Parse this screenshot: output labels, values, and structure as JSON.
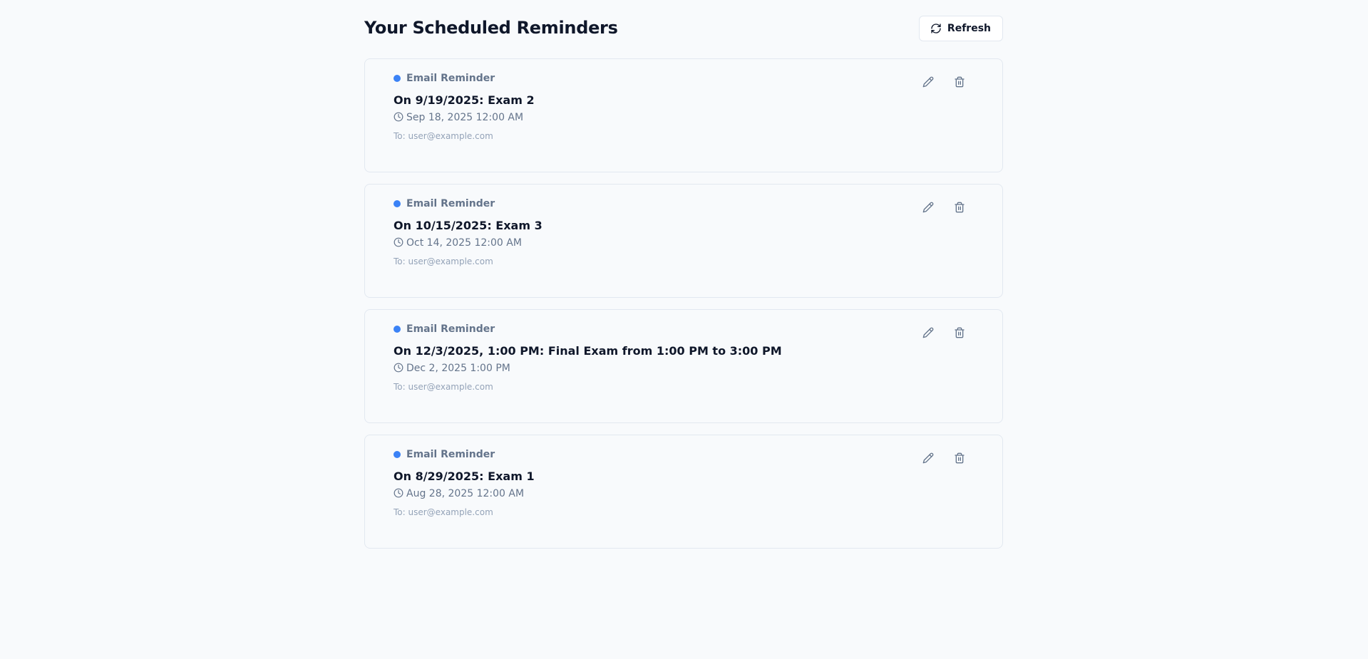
{
  "header": {
    "title": "Your Scheduled Reminders",
    "refresh_label": "Refresh"
  },
  "reminders": [
    {
      "type": "Email Reminder",
      "title": "On 9/19/2025: Exam 2",
      "time": "Sep 18, 2025 12:00 AM",
      "recipient": "To: user@example.com"
    },
    {
      "type": "Email Reminder",
      "title": "On 10/15/2025: Exam 3",
      "time": "Oct 14, 2025 12:00 AM",
      "recipient": "To: user@example.com"
    },
    {
      "type": "Email Reminder",
      "title": "On 12/3/2025, 1:00 PM: Final Exam from 1:00 PM to 3:00 PM",
      "time": "Dec 2, 2025 1:00 PM",
      "recipient": "To: user@example.com"
    },
    {
      "type": "Email Reminder",
      "title": "On 8/29/2025: Exam 1",
      "time": "Aug 28, 2025 12:00 AM",
      "recipient": "To: user@example.com"
    }
  ],
  "icons": {
    "refresh": "refresh-icon",
    "clock": "clock-icon",
    "edit": "pencil-icon",
    "delete": "trash-icon",
    "type_indicator": "status-dot"
  },
  "colors": {
    "accent": "#3b82f6",
    "background": "#f8fafc",
    "border": "#e2e8f0",
    "muted_text": "#64748b",
    "faint_text": "#94a3b8"
  }
}
